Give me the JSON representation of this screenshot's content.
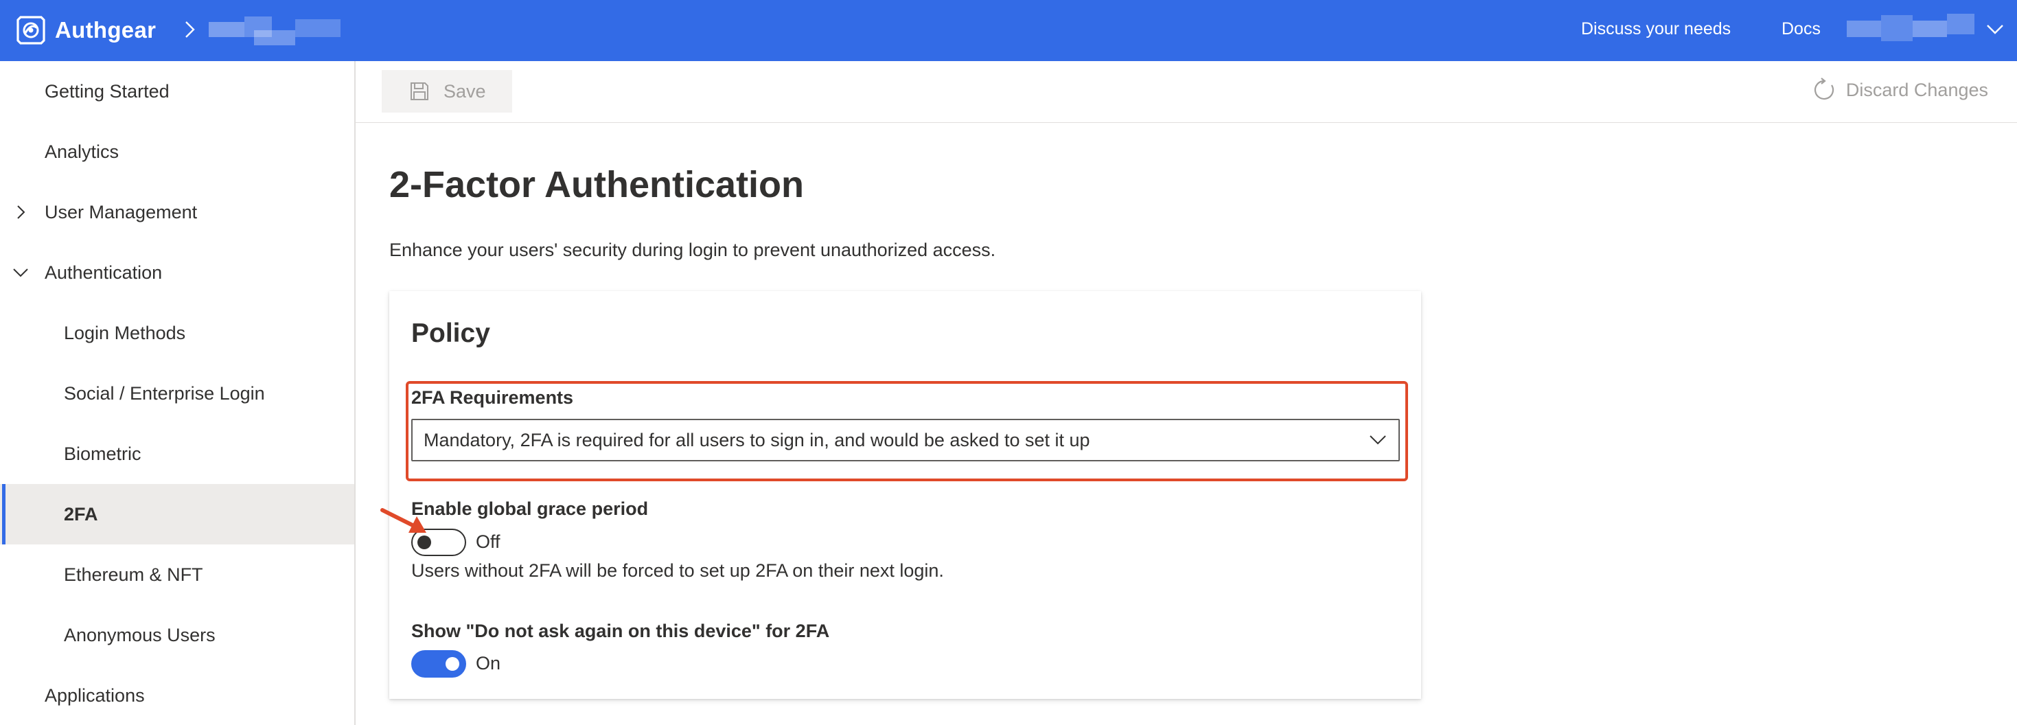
{
  "app": {
    "brand_name": "Authgear",
    "project_name_redacted": true
  },
  "topbar": {
    "links": [
      "Discuss your needs",
      "Docs"
    ],
    "account_redacted": true
  },
  "sidebar": {
    "items": [
      {
        "label": "Getting Started",
        "level": 1
      },
      {
        "label": "Analytics",
        "level": 1
      },
      {
        "label": "User Management",
        "level": 1,
        "expandable": true,
        "expanded": false
      },
      {
        "label": "Authentication",
        "level": 1,
        "expandable": true,
        "expanded": true
      },
      {
        "label": "Login Methods",
        "level": 2
      },
      {
        "label": "Social / Enterprise Login",
        "level": 2
      },
      {
        "label": "Biometric",
        "level": 2
      },
      {
        "label": "2FA",
        "level": 2,
        "selected": true
      },
      {
        "label": "Ethereum & NFT",
        "level": 2
      },
      {
        "label": "Anonymous Users",
        "level": 2
      },
      {
        "label": "Applications",
        "level": 1
      }
    ]
  },
  "commandbar": {
    "save_label": "Save",
    "discard_label": "Discard Changes",
    "save_enabled": false
  },
  "page": {
    "title": "2-Factor Authentication",
    "description": "Enhance your users' security during login to prevent unauthorized access."
  },
  "policy": {
    "title": "Policy",
    "requirements_label": "2FA Requirements",
    "requirements_value": "Mandatory, 2FA is required for all users to sign in, and would be asked to set it up",
    "grace_label": "Enable global grace period",
    "grace_state": "Off",
    "grace_hint": "Users without 2FA will be forced to set up 2FA on their next login.",
    "dont_ask_label": "Show \"Do not ask again on this device\" for 2FA",
    "dont_ask_state": "On"
  },
  "colors": {
    "brand": "#336be6",
    "highlight": "#e04a2a",
    "selected_bg": "#edebe9"
  }
}
